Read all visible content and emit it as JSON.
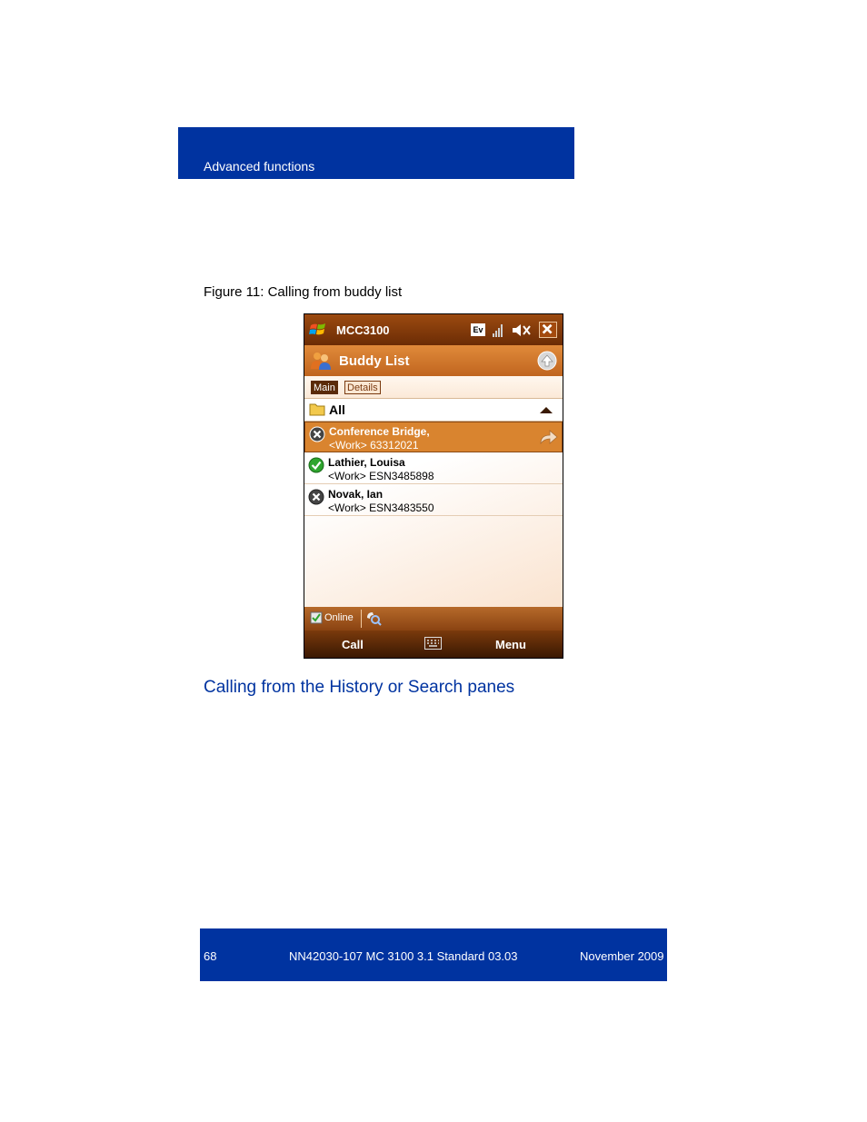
{
  "header": {
    "section": "Advanced functions"
  },
  "figure": {
    "caption": "Figure 11: Calling from buddy list"
  },
  "phone": {
    "title": "MCC3100",
    "ev_badge": "Ev",
    "app_title": "Buddy List",
    "tabs": [
      {
        "label": "Main"
      },
      {
        "label": "Details"
      }
    ],
    "group": {
      "label": "All"
    },
    "buddies": [
      {
        "name": "Conference Bridge,",
        "number": "<Work> 63312021",
        "status": "offline",
        "selected": true
      },
      {
        "name": "Lathier, Louisa",
        "number": "<Work> ESN3485898",
        "status": "online",
        "selected": false
      },
      {
        "name": "Novak, Ian",
        "number": "<Work> ESN3483550",
        "status": "offline",
        "selected": false
      }
    ],
    "status_bar": {
      "presence": "Online"
    },
    "softkeys": {
      "left": "Call",
      "right": "Menu"
    }
  },
  "section_heading": "Calling from the History or Search panes",
  "footer": {
    "page": "68",
    "doc": "NN42030-107 MC 3100  3.1 Standard 03.03",
    "date": "November 2009"
  },
  "colors": {
    "brand_blue": "#0033a0",
    "selected_row": "#d9842f",
    "online_green": "#2ea52e",
    "offline_gray": "#444444"
  }
}
